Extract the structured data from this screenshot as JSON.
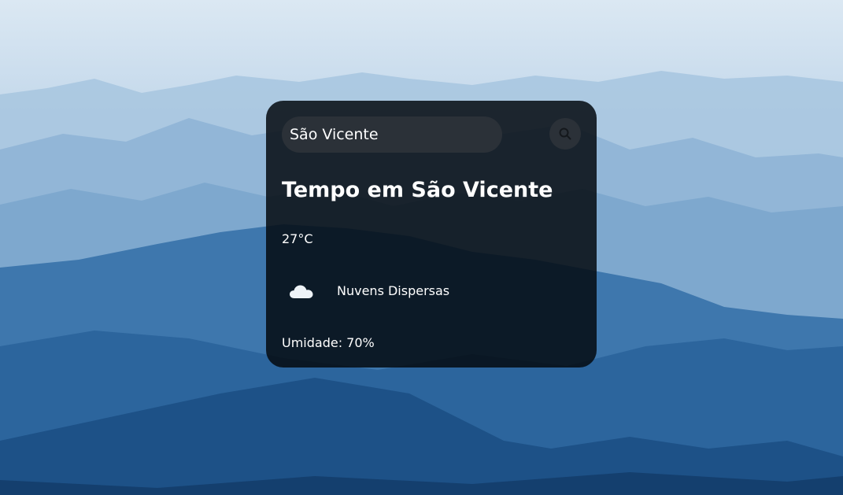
{
  "search": {
    "value": "São Vicente",
    "button_icon": "search-icon"
  },
  "weather": {
    "title": "Tempo em São Vicente",
    "temperature": "27°C",
    "icon": "cloud-icon",
    "description": "Nuvens Dispersas",
    "humidity": "Umidade: 70%"
  },
  "colors": {
    "card_background": "#0a1118",
    "input_background": "#2b3138",
    "text": "#ffffff"
  }
}
